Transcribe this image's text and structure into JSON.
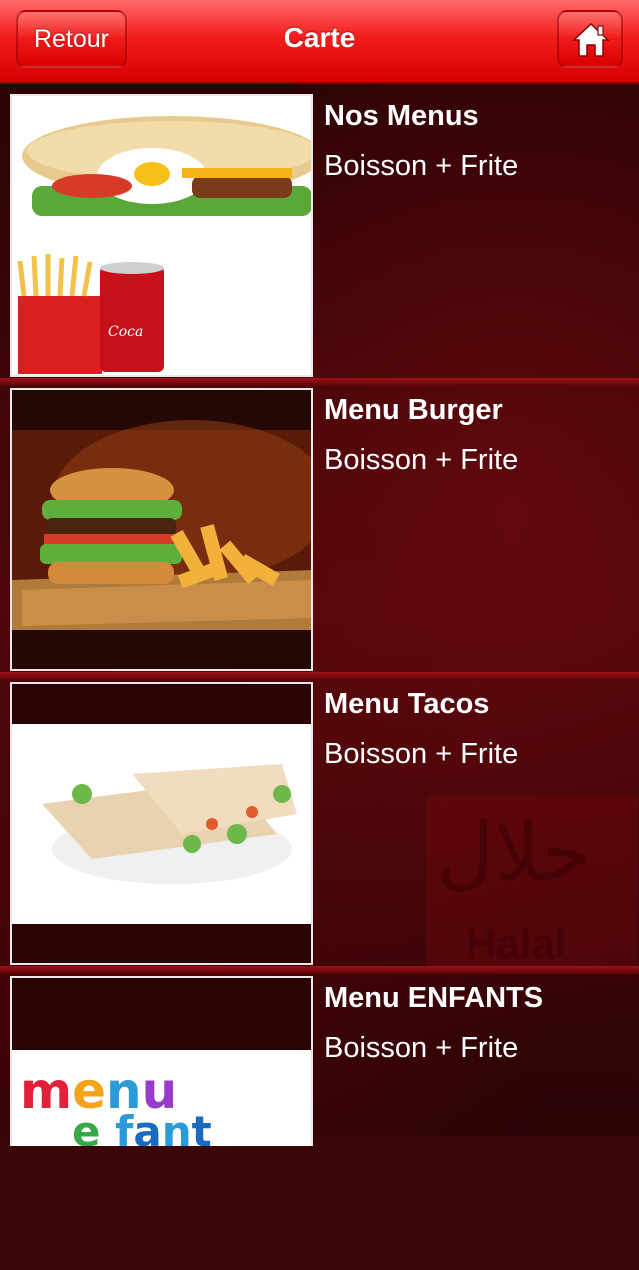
{
  "nav": {
    "title": "Carte",
    "back_label": "Retour",
    "home_icon": "home-icon"
  },
  "items": [
    {
      "title": "Nos Menus",
      "subtitle": "Boisson + Frite",
      "image": "kebab-fries-coke-photo"
    },
    {
      "title": "Menu Burger",
      "subtitle": "Boisson + Frite",
      "image": "burger-fries-photo"
    },
    {
      "title": "Menu Tacos",
      "subtitle": "Boisson + Frite",
      "image": "tacos-wrap-photo"
    },
    {
      "title": "Menu ENFANTS",
      "subtitle": "Boisson + Frite",
      "image": "menu-enfant-logo"
    }
  ],
  "watermark": {
    "latin": "Halal",
    "arabic": "حلال"
  },
  "colors": {
    "nav_red": "#f21d1d",
    "background": "#3a0608",
    "text": "#ffffff"
  }
}
